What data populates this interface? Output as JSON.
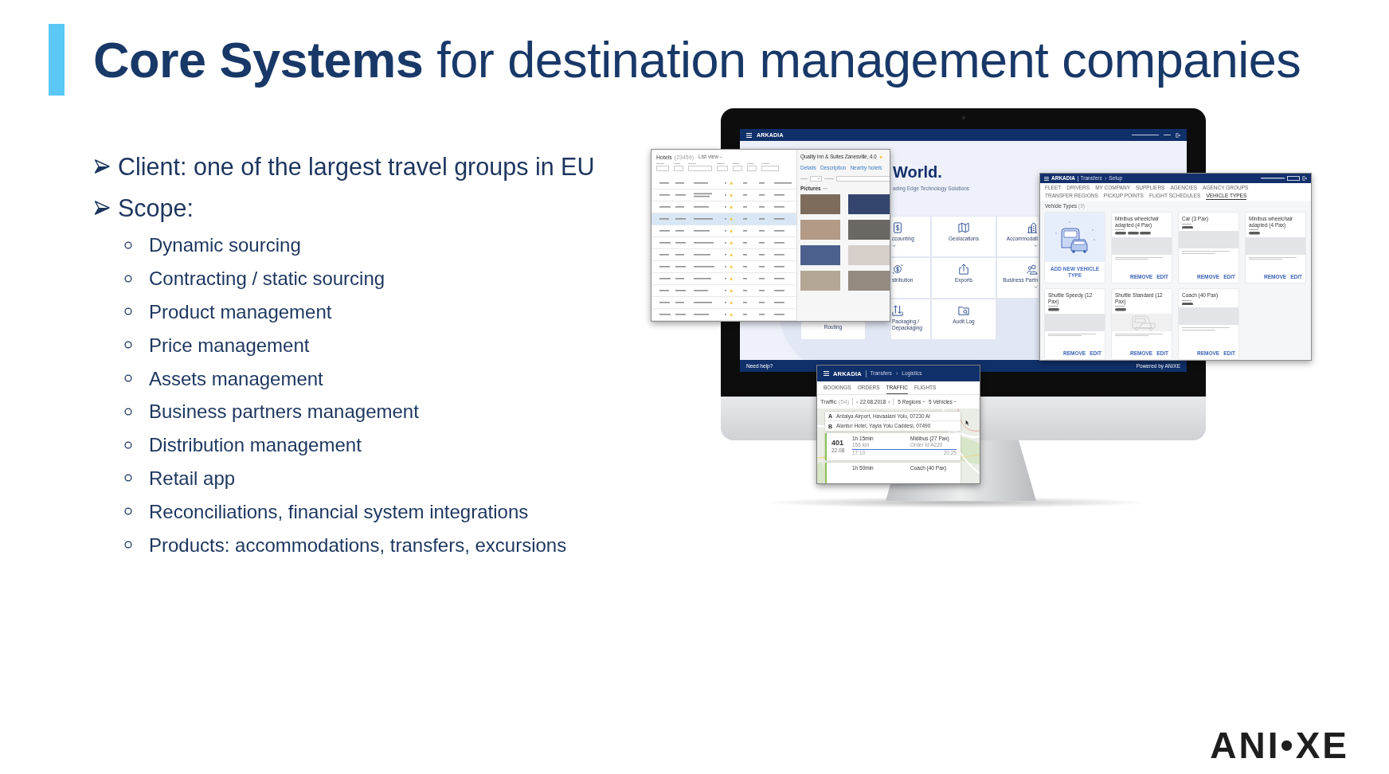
{
  "title": "**Core Systems** for destination management companies",
  "bullets": [
    {
      "text": "Client: one of the largest travel groups in EU"
    },
    {
      "text": "Scope:",
      "children": [
        {
          "text": "Dynamic sourcing"
        },
        {
          "text": "Contracting / static sourcing"
        },
        {
          "text": "Product management"
        },
        {
          "text": "Price management"
        },
        {
          "text": "Assets management"
        },
        {
          "text": "Business partners management"
        },
        {
          "text": "Distribution management"
        },
        {
          "text": "Retail app"
        },
        {
          "text": "Reconciliations, financial system integrations"
        },
        {
          "text": "Products: accommodations, transfers, excursions"
        }
      ]
    }
  ],
  "monitor_screen": {
    "app_name": "ARKADIA",
    "heading": "World.",
    "subheading": "ading Edge Technology Solutions",
    "tiles": [
      {
        "label": "ccounting",
        "kind": "leftcut",
        "expandable": true
      },
      {
        "label": "Geolocations",
        "kind": "whole",
        "expandable": false
      },
      {
        "label": "Accommodati",
        "kind": "rightcut",
        "expandable": true
      },
      {
        "label": "stribution",
        "kind": "leftcut",
        "expandable": false
      },
      {
        "label": "Exports",
        "kind": "whole",
        "expandable": false
      },
      {
        "label": "Business Partn",
        "kind": "rightcut",
        "expandable": true
      },
      {
        "label": "Routing",
        "kind": "topcut",
        "expandable": false
      },
      {
        "label": "Packaging / Depackaging",
        "kind": "leftcut",
        "expandable": false
      },
      {
        "label": "Audit Log",
        "kind": "whole",
        "expandable": false
      }
    ],
    "footer_link": "Need help?",
    "footer_credit": "Powered by ANIXE"
  },
  "hotels_window": {
    "title": "Hotels",
    "count": "(23459)",
    "view": "List view",
    "rows": [
      {
        "selected": false
      },
      {
        "selected": false
      },
      {
        "selected": false
      },
      {
        "selected": true
      },
      {
        "selected": false
      },
      {
        "selected": false
      },
      {
        "selected": false
      },
      {
        "selected": false
      },
      {
        "selected": false
      },
      {
        "selected": false
      },
      {
        "selected": false
      },
      {
        "selected": false
      }
    ],
    "detail": {
      "title": "Quality Inn & Suites Zanesville, 4.0",
      "tabs": [
        "Details",
        "Description",
        "Nearby hotels"
      ],
      "section": "Pictures"
    }
  },
  "vehicle_types_window": {
    "app_name": "ARKADIA",
    "breadcrumb": [
      "Transfers",
      "Setup"
    ],
    "tabs": [
      {
        "label": "FLEET",
        "selected": false
      },
      {
        "label": "DRIVERS",
        "selected": false
      },
      {
        "label": "MY COMPANY",
        "selected": false
      },
      {
        "label": "SUPPLIERS",
        "selected": false
      },
      {
        "label": "AGENCIES",
        "selected": false
      },
      {
        "label": "AGENCY GROUPS",
        "selected": false
      },
      {
        "label": "TRANSFER REGIONS",
        "selected": false
      },
      {
        "label": "PICKUP POINTS",
        "selected": false
      },
      {
        "label": "FLIGHT SCHEDULES",
        "selected": false
      },
      {
        "label": "VEHICLE TYPES",
        "selected": true
      }
    ],
    "heading": "Vehicle Types",
    "count": "(9)",
    "add_label": "ADD NEW VEHICLE TYPE",
    "cards": [
      {
        "title": "Minibus wheelchair adapted (4 Pax)",
        "kind": "photo",
        "actions": [
          "REMOVE",
          "EDIT"
        ]
      },
      {
        "title": "Car (3 Pax)",
        "kind": "photo",
        "actions": [
          "REMOVE",
          "EDIT"
        ]
      },
      {
        "title": "Minibus wheelchair adapted (4 Pax)",
        "kind": "photo",
        "actions": [
          "REMOVE",
          "EDIT"
        ]
      },
      {
        "title": "Shuttle Speedy (12 Pax)",
        "kind": "photo",
        "actions": [
          "REMOVE",
          "EDIT"
        ]
      },
      {
        "title": "Shuttle Standard (12 Pax)",
        "kind": "sketch",
        "actions": [
          "REMOVE",
          "EDIT"
        ]
      },
      {
        "title": "Coach (40 Pax)",
        "kind": "photo",
        "actions": [
          "REMOVE",
          "EDIT"
        ]
      }
    ]
  },
  "traffic_window": {
    "app_name": "ARKADIA",
    "breadcrumb": [
      "Transfers",
      "Logistics"
    ],
    "tabs": [
      {
        "label": "BOOKINGS",
        "selected": false
      },
      {
        "label": "ORDERS",
        "selected": false
      },
      {
        "label": "TRAFFIC",
        "selected": true
      },
      {
        "label": "FLIGHTS",
        "selected": false
      }
    ],
    "heading": "Traffic",
    "count": "(54)",
    "date": "22.08.2018",
    "filters": [
      "5 Regions",
      "5 Vehicles"
    ],
    "route": [
      {
        "marker": "A",
        "address": "Antalya Airport, Havaalani Yolu, 07230 Al"
      },
      {
        "marker": "B",
        "address": "Alantur Hotel, Yayla Yolu Caddesi, 07490"
      }
    ],
    "trips": [
      {
        "number": "401",
        "date": "22.08",
        "duration": "1h 15min",
        "distance": "156 km",
        "vehicle": "Midibus (27 Pax)",
        "order": "Order Id A220",
        "start_time": "17:10",
        "end_time": "20:25"
      },
      {
        "duration": "1h 50min",
        "vehicle": "Coach (40 Pax)"
      }
    ]
  },
  "logo": "ANI•XE"
}
